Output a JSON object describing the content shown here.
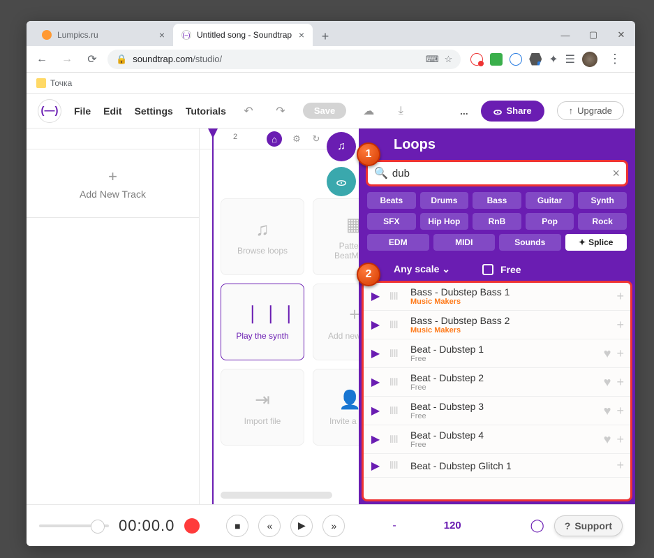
{
  "browser": {
    "tabs": [
      {
        "favicon": "#ff9933",
        "title": "Lumpics.ru"
      },
      {
        "favicon": "#ffffff",
        "title": "Untitled song - Soundtrap"
      }
    ],
    "url_domain": "soundtrap.com",
    "url_path": "/studio/",
    "bookmark": "Точка"
  },
  "app": {
    "menu": [
      "File",
      "Edit",
      "Settings",
      "Tutorials"
    ],
    "save": "Save",
    "share": "Share",
    "upgrade": "Upgrade",
    "more": "..."
  },
  "sidebar": {
    "add_track": "Add New Track"
  },
  "cards": [
    {
      "icon": "♫",
      "label": "Browse loops"
    },
    {
      "icon": "▦",
      "label": "Patterns BeatMaker"
    },
    {
      "icon": "⎹⎹⎹",
      "label": "Play the synth",
      "active": true
    },
    {
      "icon": "+",
      "label": "Add new track"
    },
    {
      "icon": "⇥",
      "label": "Import file"
    },
    {
      "icon": "👤⁺",
      "label": "Invite a friend"
    }
  ],
  "ruler": {
    "mark": "2"
  },
  "loops": {
    "title": "Loops",
    "search": "dub",
    "tags": [
      "Beats",
      "Drums",
      "Bass",
      "Guitar",
      "Synth",
      "SFX",
      "Hip Hop",
      "RnB",
      "Pop",
      "Rock",
      "EDM",
      "MIDI",
      "Sounds",
      "Splice"
    ],
    "filter_scale": "Any scale",
    "filter_free": "Free",
    "results": [
      {
        "title": "Bass - Dubstep Bass 1",
        "sub": "Music Makers",
        "sub_style": "orange",
        "fav": false
      },
      {
        "title": "Bass - Dubstep Bass 2",
        "sub": "Music Makers",
        "sub_style": "orange",
        "fav": false
      },
      {
        "title": "Beat - Dubstep 1",
        "sub": "Free",
        "sub_style": "grey",
        "fav": true
      },
      {
        "title": "Beat - Dubstep 2",
        "sub": "Free",
        "sub_style": "grey",
        "fav": true
      },
      {
        "title": "Beat - Dubstep 3",
        "sub": "Free",
        "sub_style": "grey",
        "fav": true
      },
      {
        "title": "Beat - Dubstep 4",
        "sub": "Free",
        "sub_style": "grey",
        "fav": true
      },
      {
        "title": "Beat - Dubstep Glitch 1",
        "sub": "",
        "sub_style": "grey",
        "fav": false
      }
    ]
  },
  "callouts": {
    "one": "1",
    "two": "2"
  },
  "transport": {
    "time": "00:00.0",
    "dash": "-",
    "bpm": "120",
    "support": "Support"
  }
}
